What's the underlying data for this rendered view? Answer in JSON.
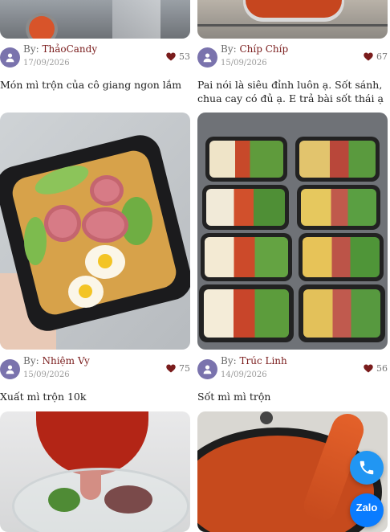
{
  "colors": {
    "accent": "#7a1c1c",
    "avatar": "#7a73ad",
    "phone": "#2196f3",
    "zalo": "#0a7cff"
  },
  "cards": [
    {
      "author_prefix": "By:",
      "author": "ThảoCandy",
      "date": "17/09/2026",
      "likes": "53",
      "title": "Món mì trộn của cô giang ngon lắm",
      "image": "food-photo-noodle-bowl"
    },
    {
      "author_prefix": "By:",
      "author": "Chíp Chíp",
      "date": "15/09/2026",
      "likes": "67",
      "title": "Pai nói là siêu đỉnh luôn ạ. Sốt sánh, chua cay có đủ ạ. E trả bài sốt thái ạ",
      "image": "food-photo-cooking-pot"
    },
    {
      "author_prefix": "By:",
      "author": "Nhiệm Vy",
      "date": "15/09/2026",
      "likes": "75",
      "title": "Xuất mì trộn 10k",
      "image": "food-photo-mixed-noodles-box"
    },
    {
      "author_prefix": "By:",
      "author": "Trúc Linh",
      "date": "14/09/2026",
      "likes": "56",
      "title": "Sốt mì mì trộn",
      "image": "food-photo-meal-prep-boxes"
    },
    {
      "image": "food-photo-sauce-pour-bowl"
    },
    {
      "image": "food-photo-sauce-pour-pan"
    }
  ],
  "floating": {
    "phone_icon": "phone-icon",
    "zalo_label": "Zalo"
  }
}
